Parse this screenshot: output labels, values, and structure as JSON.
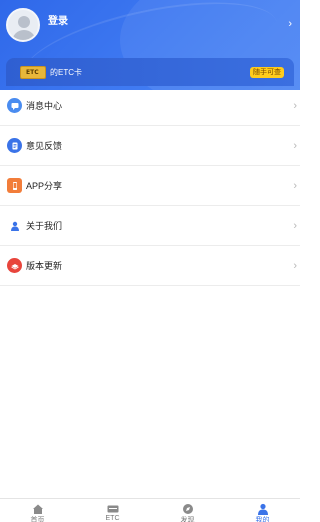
{
  "header": {
    "login_label": "登录",
    "chevron": "›"
  },
  "etc_banner": {
    "card_icon_text": "ETC",
    "label": "的ETC卡",
    "badge": "随手可查"
  },
  "menu": {
    "items": [
      {
        "label": "消息中心",
        "icon": "message-icon",
        "color": "#4a8cf0"
      },
      {
        "label": "意见反馈",
        "icon": "feedback-icon",
        "color": "#3a73e8"
      },
      {
        "label": "APP分享",
        "icon": "share-icon",
        "color": "#f27d3a"
      },
      {
        "label": "关于我们",
        "icon": "user-icon",
        "color": "#3a73e8"
      },
      {
        "label": "版本更新",
        "icon": "update-icon",
        "color": "#e8453c"
      }
    ],
    "chevron": "›"
  },
  "tabbar": {
    "tabs": [
      {
        "label": "首页",
        "icon": "home-icon"
      },
      {
        "label": "ETC",
        "icon": "etc-card-icon"
      },
      {
        "label": "发现",
        "icon": "discover-icon"
      },
      {
        "label": "我的",
        "icon": "profile-icon",
        "active": true
      }
    ]
  },
  "colors": {
    "header_blue": "#3a73e8",
    "badge_yellow": "#ffcc1c",
    "active_tab": "#3a73e8"
  }
}
